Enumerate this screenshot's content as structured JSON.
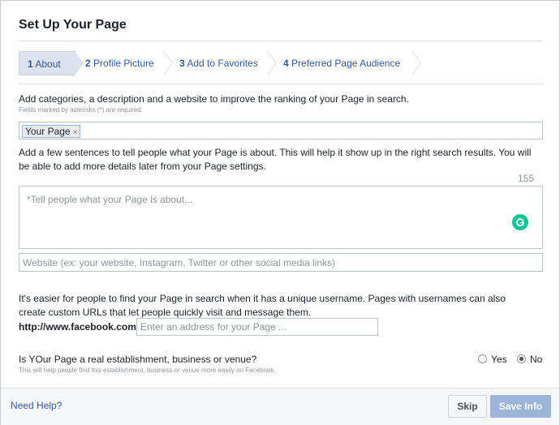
{
  "dialog": {
    "title": "Set Up Your Page"
  },
  "steps": [
    {
      "num": "1",
      "label": "About",
      "active": true
    },
    {
      "num": "2",
      "label": "Profile Picture",
      "active": false
    },
    {
      "num": "3",
      "label": "Add to Favorites",
      "active": false
    },
    {
      "num": "4",
      "label": "Preferred Page Audience",
      "active": false
    }
  ],
  "about": {
    "intro": "Add categories, a description and a website to improve the ranking of your Page in search.",
    "required_note": "Fields marked by asterisks (*) are required.",
    "category_token": "Your Page",
    "token_remove": "×",
    "desc_help_line1": "Add a few sentences to tell people what your Page is about. This will help it show up in the right search results. You will",
    "desc_help_line2": "be able to add more details later from your Page settings.",
    "char_counter": "155",
    "desc_placeholder": "*Tell people what your Page is about...",
    "website_placeholder": "Website (ex: your website, Instagram, Twitter or other social media links)",
    "username_help_line1": "It's easier for people to find your Page in search when it has a unique username. Pages with usernames can also",
    "username_help_line2": "create custom URLs that let people quickly visit and message them.",
    "url_prefix": "http://www.facebook.com/",
    "username_placeholder": "Enter an address for your Page ...",
    "venue_question": "Is YOur Page a real establishment, business or venue?",
    "venue_note": "This will help people find this establishment, business or venue more easily on Facebook.",
    "venue_options": [
      {
        "label": "Yes",
        "selected": false
      },
      {
        "label": "No",
        "selected": true
      }
    ]
  },
  "footer": {
    "help_link": "Need Help?",
    "skip_label": "Skip",
    "save_label": "Save Info"
  },
  "colors": {
    "link": "#365899",
    "active_step_bg": "#dce3ef",
    "save_button_disabled": "#9cb4d8",
    "grammarly": "#15c39a"
  }
}
